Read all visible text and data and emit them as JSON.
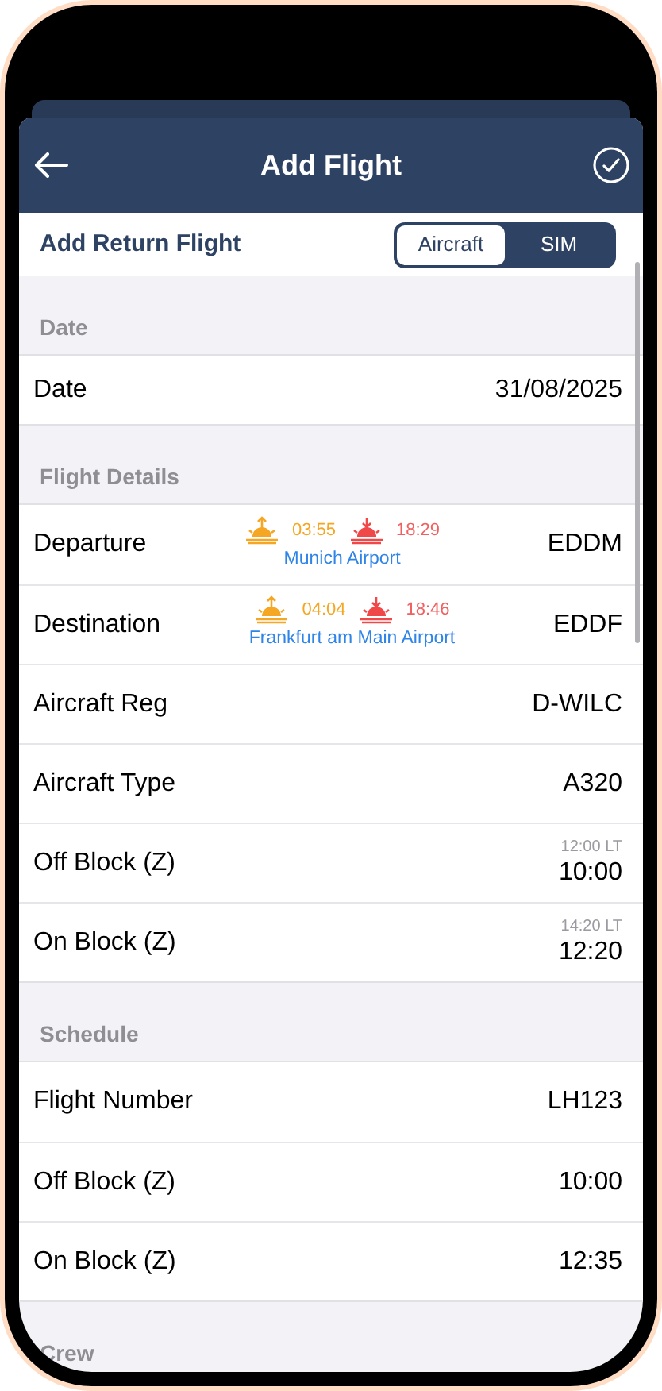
{
  "header": {
    "title": "Add Flight"
  },
  "return_flight": {
    "label": "Add Return Flight",
    "segments": [
      {
        "label": "Aircraft",
        "selected": true
      },
      {
        "label": "SIM",
        "selected": false
      }
    ]
  },
  "sections": [
    {
      "title": "Date",
      "rows": [
        {
          "kind": "value",
          "label": "Date",
          "value": "31/08/2025"
        }
      ]
    },
    {
      "title": "Flight Details",
      "rows": [
        {
          "kind": "airport",
          "label": "Departure",
          "sunrise": "03:55",
          "sunset": "18:29",
          "airport": "Munich Airport",
          "value": "EDDM"
        },
        {
          "kind": "airport",
          "label": "Destination",
          "sunrise": "04:04",
          "sunset": "18:46",
          "airport": "Frankfurt am Main Airport",
          "value": "EDDF"
        },
        {
          "kind": "value",
          "label": "Aircraft Reg",
          "value": "D-WILC"
        },
        {
          "kind": "value",
          "label": "Aircraft Type",
          "value": "A320"
        },
        {
          "kind": "time",
          "label": "Off Block (Z)",
          "local": "12:00 LT",
          "value": "10:00"
        },
        {
          "kind": "time",
          "label": "On Block (Z)",
          "local": "14:20 LT",
          "value": "12:20"
        }
      ]
    },
    {
      "title": "Schedule",
      "rows": [
        {
          "kind": "value",
          "label": "Flight Number",
          "value": "LH123"
        },
        {
          "kind": "value",
          "label": "Off Block (Z)",
          "value": "10:00"
        },
        {
          "kind": "value",
          "label": "On Block (Z)",
          "value": "12:35"
        }
      ]
    },
    {
      "title": "Crew"
    }
  ]
}
